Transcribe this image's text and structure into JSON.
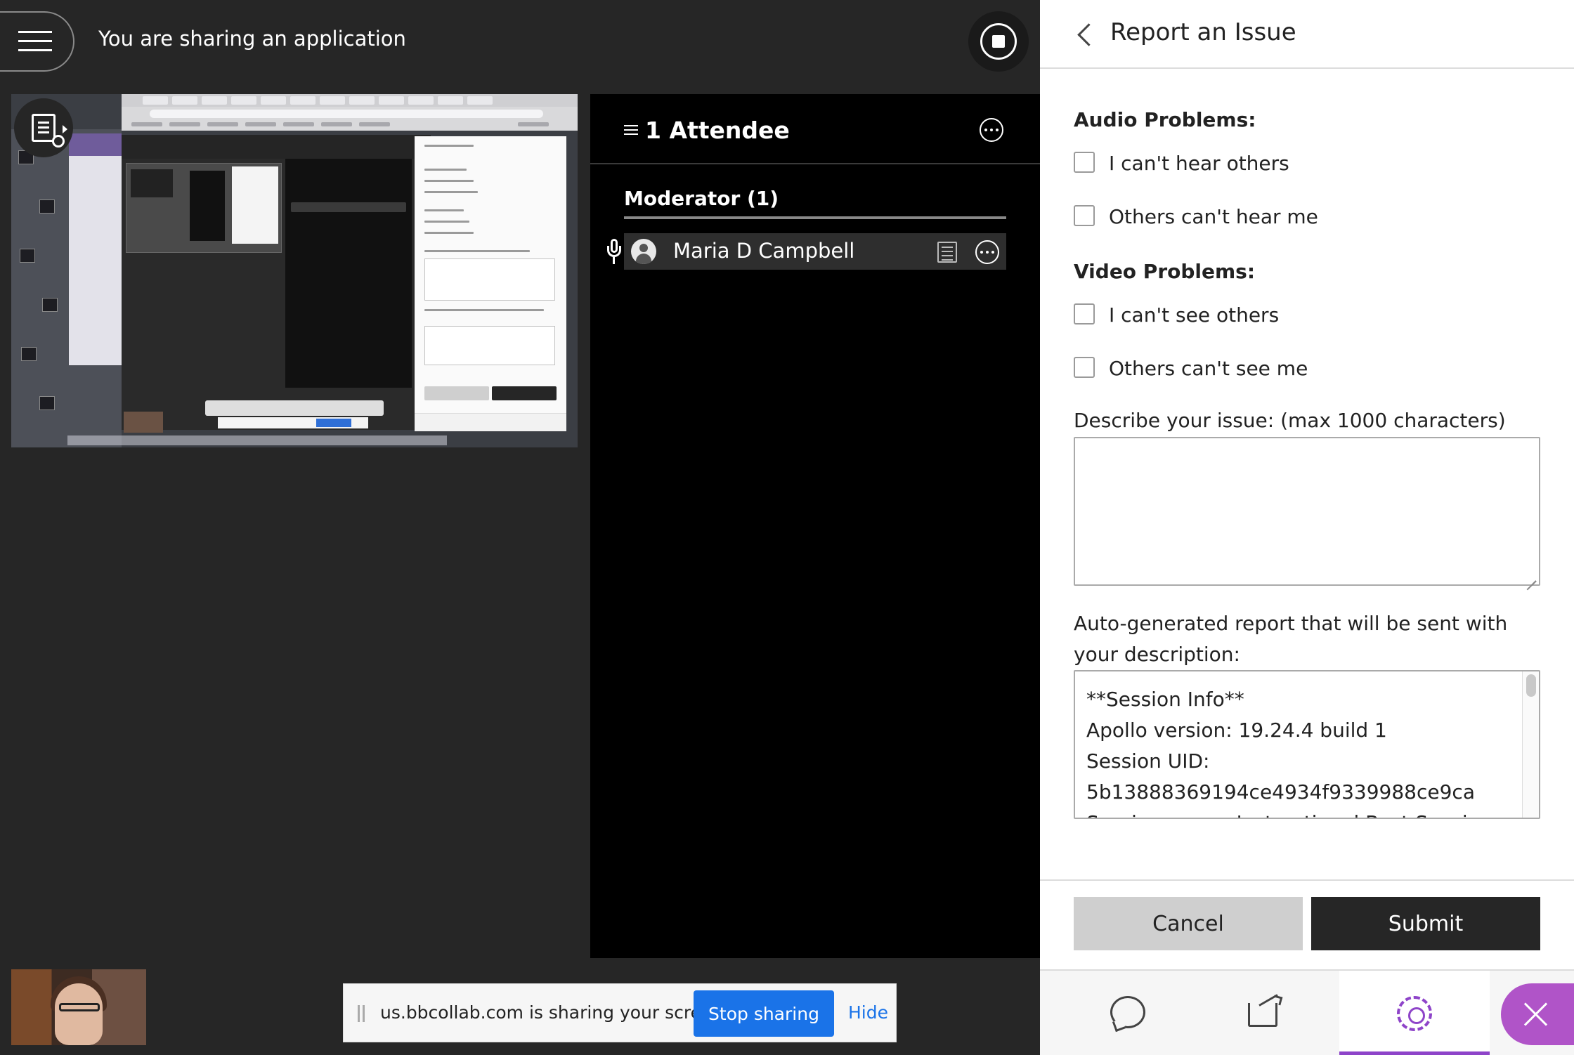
{
  "top_bar": {
    "status_text": "You are sharing an application"
  },
  "attendees": {
    "title": "1 Attendee",
    "moderator_heading": "Moderator (1)",
    "members": [
      {
        "name": "Maria D Campbell"
      }
    ]
  },
  "report": {
    "title": "Report an Issue",
    "audio_heading": "Audio Problems:",
    "audio_options": [
      "I can't hear others",
      "Others can't hear me"
    ],
    "video_heading": "Video Problems:",
    "video_options": [
      "I can't see others",
      "Others can't see me"
    ],
    "describe_label": "Describe your issue: (max 1000 characters)",
    "describe_value": "",
    "auto_label": "Auto-generated report that will be sent with your description:",
    "auto_report_lines": [
      "**Session Info**",
      "Apollo version: 19.24.4 build 1",
      "Session UID:",
      "5b13888369194ce4934f9339988ce9ca",
      "Session name: Instructional Best Seesion"
    ],
    "cancel_label": "Cancel",
    "submit_label": "Submit"
  },
  "bottom_tabs": {
    "active": "settings",
    "accent_color": "#8e44c9"
  },
  "share_banner": {
    "text": "us.bbcollab.com is sharing your screen.",
    "stop_label": "Stop sharing",
    "hide_label": "Hide",
    "button_color": "#1a73e8"
  }
}
